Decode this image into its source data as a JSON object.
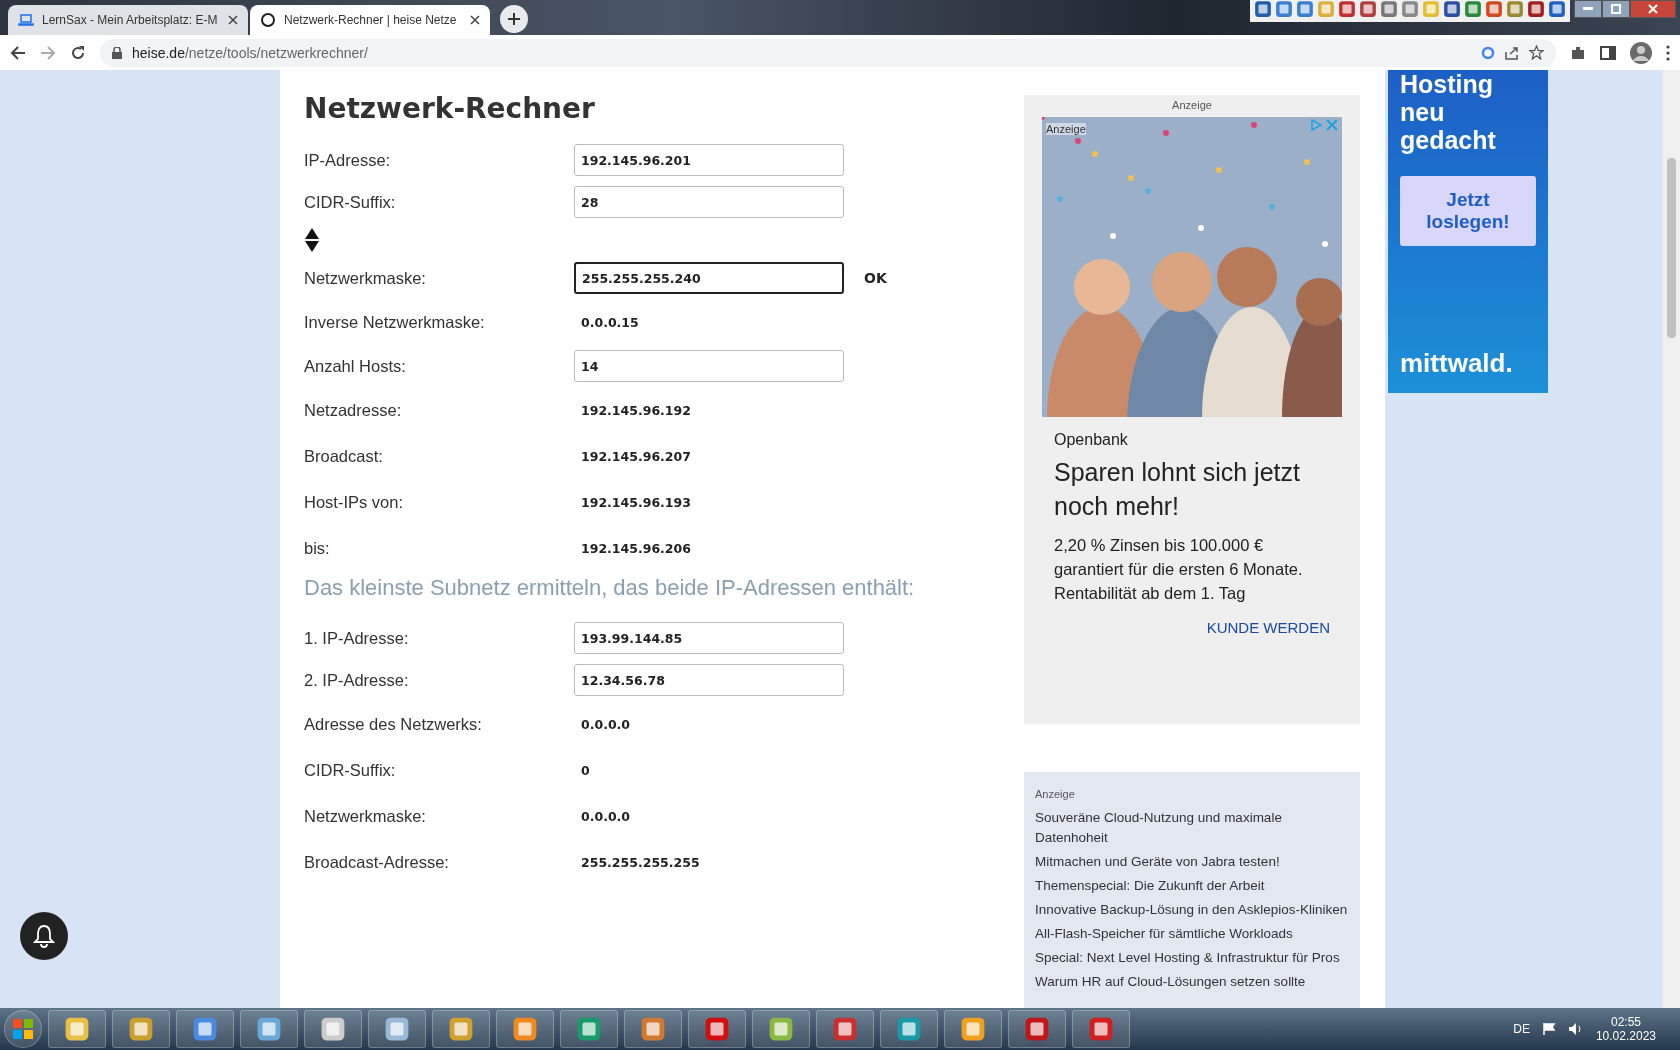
{
  "browser": {
    "tabs": [
      {
        "title": "LernSax - Mein Arbeitsplatz: E-M",
        "selected": false
      },
      {
        "title": "Netzwerk-Rechner | heise Netze",
        "selected": true
      }
    ],
    "url": {
      "host": "heise.de",
      "path": "/netze/tools/netzwerkrechner/"
    }
  },
  "calculator": {
    "title": "Netzwerk-Rechner",
    "fields": [
      {
        "label": "IP-Adresse:",
        "kind": "input",
        "value": "192.145.96.201",
        "focused": false
      },
      {
        "label": "CIDR-Suffix:",
        "kind": "input",
        "value": "28",
        "focused": false
      },
      {
        "kind": "spinner"
      },
      {
        "label": "Netzwerkmaske:",
        "kind": "input",
        "value": "255.255.255.240",
        "focused": true,
        "button": "OK"
      },
      {
        "label": "Inverse Netzwerkmaske:",
        "kind": "output",
        "value": "0.0.0.15"
      },
      {
        "label": "Anzahl Hosts:",
        "kind": "input",
        "value": "14",
        "focused": false
      },
      {
        "label": "Netzadresse:",
        "kind": "output",
        "value": "192.145.96.192"
      },
      {
        "label": "Broadcast:",
        "kind": "output",
        "value": "192.145.96.207"
      },
      {
        "label": "Host-IPs von:",
        "kind": "output",
        "value": "192.145.96.193"
      },
      {
        "label": "bis:",
        "kind": "output",
        "value": "192.145.96.206"
      }
    ],
    "subnet_heading": "Das kleinste Subnetz ermitteln, das beide IP-Adressen enthält:",
    "subnet_fields": [
      {
        "label": "1. IP-Adresse:",
        "kind": "input",
        "value": "193.99.144.85",
        "focused": false
      },
      {
        "label": "2. IP-Adresse:",
        "kind": "input",
        "value": "12.34.56.78",
        "focused": false
      },
      {
        "label": "Adresse des Netzwerks:",
        "kind": "output",
        "value": "0.0.0.0"
      },
      {
        "label": "CIDR-Suffix:",
        "kind": "output",
        "value": "0"
      },
      {
        "label": "Netzwerkmaske:",
        "kind": "output",
        "value": "0.0.0.0"
      },
      {
        "label": "Broadcast-Adresse:",
        "kind": "output",
        "value": "255.255.255.255"
      }
    ]
  },
  "ad": {
    "label": "Anzeige",
    "image_label": "Anzeige",
    "advertiser": "Openbank",
    "headline": "Sparen lohnt sich jetzt noch mehr!",
    "body": "2,20 % Zinsen bis 100.000 € garantiert für die ersten 6 Monate. Rentabilität ab dem 1. Tag",
    "cta": "KUNDE WERDEN"
  },
  "ad_links": {
    "label": "Anzeige",
    "items": [
      "Souveräne Cloud-Nutzung und maximale Datenhoheit",
      "Mitmachen und Geräte von Jabra testen!",
      "Themenspecial: Die Zukunft der Arbeit",
      "Innovative Backup-Lösung in den Asklepios-Kliniken",
      "All-Flash-Speicher für sämtliche Workloads",
      "Special: Next Level Hosting & Infrastruktur für Pros",
      "Warum HR auf Cloud-Lösungen setzen sollte"
    ]
  },
  "banner": {
    "headline": "Hosting neu gedacht",
    "button": "Jetzt loslegen!",
    "brand": "mittwald."
  },
  "taskbar": {
    "language": "DE",
    "time": "02:55",
    "date": "10.02.2023"
  }
}
